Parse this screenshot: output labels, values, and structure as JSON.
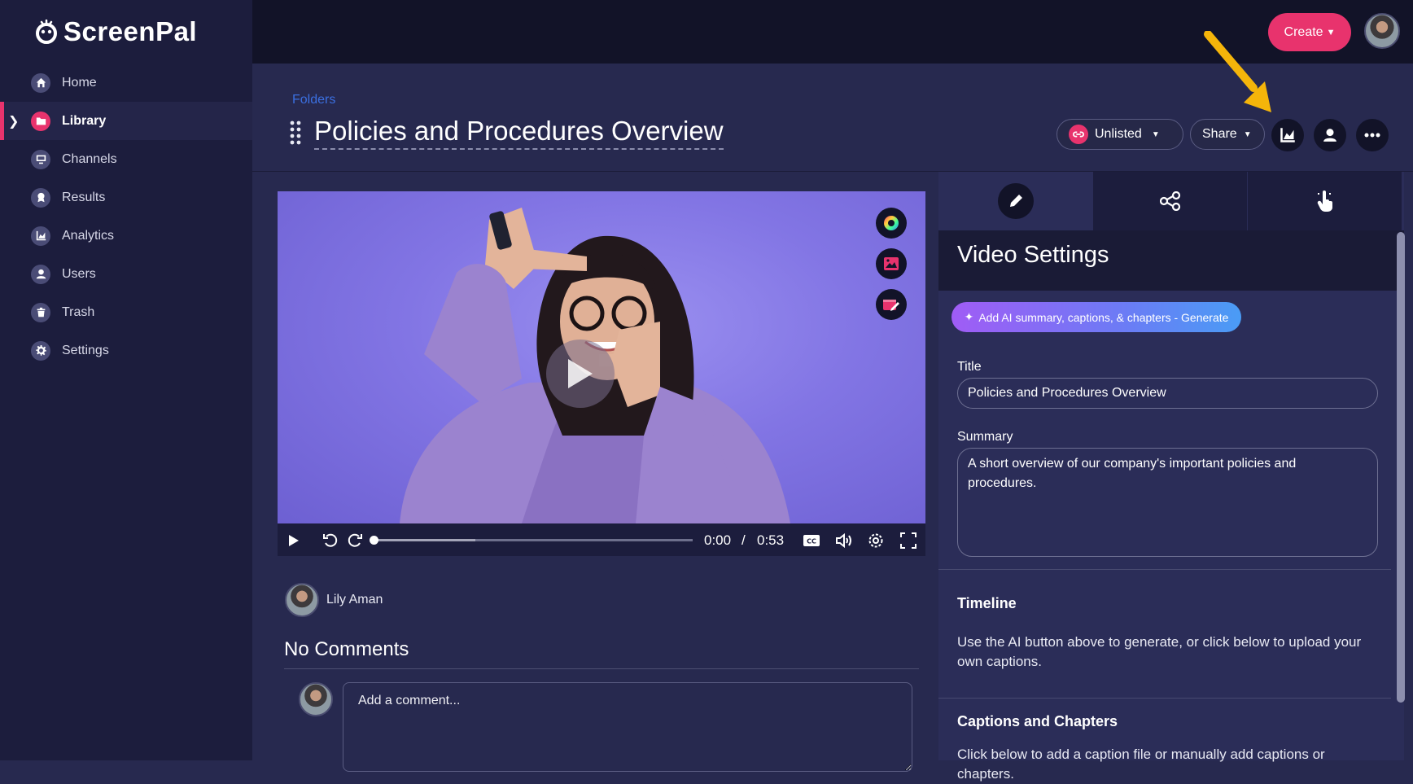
{
  "app": {
    "name": "ScreenPal"
  },
  "sidebar": {
    "items": [
      {
        "label": "Home",
        "icon": "home-icon"
      },
      {
        "label": "Library",
        "icon": "folder-icon",
        "active": true
      },
      {
        "label": "Channels",
        "icon": "monitor-icon"
      },
      {
        "label": "Results",
        "icon": "badge-icon"
      },
      {
        "label": "Analytics",
        "icon": "chart-icon"
      },
      {
        "label": "Users",
        "icon": "user-icon"
      },
      {
        "label": "Trash",
        "icon": "trash-icon"
      },
      {
        "label": "Settings",
        "icon": "gear-icon"
      }
    ]
  },
  "topbar": {
    "create_label": "Create"
  },
  "header": {
    "breadcrumb": "Folders",
    "title": "Policies and Procedures Overview",
    "visibility_label": "Unlisted",
    "share_label": "Share"
  },
  "player": {
    "current_time": "0:00",
    "separator": "/",
    "duration": "0:53",
    "progress_fraction": 0.0,
    "buffered_fraction": 0.32
  },
  "below_video": {
    "author": "Lily Aman",
    "comments_heading": "No Comments",
    "comment_placeholder": "Add a comment..."
  },
  "panel": {
    "heading": "Video Settings",
    "ai_button_label": "Add AI summary, captions, & chapters - Generate",
    "title_label": "Title",
    "title_value": "Policies and Procedures Overview",
    "summary_label": "Summary",
    "summary_value": "A short overview of our company's important policies and procedures.",
    "timeline_heading": "Timeline",
    "timeline_text": "Use the AI button above to generate, or click below to upload your own captions.",
    "captions_heading": "Captions and Chapters",
    "captions_text": "Click below to add a caption file or manually add captions or chapters."
  },
  "colors": {
    "accent": "#e8336d",
    "sidebar_bg": "#1c1d3d",
    "topbar_bg": "#121328",
    "main_bg": "#27294f",
    "annotation_arrow": "#f5b50a"
  }
}
